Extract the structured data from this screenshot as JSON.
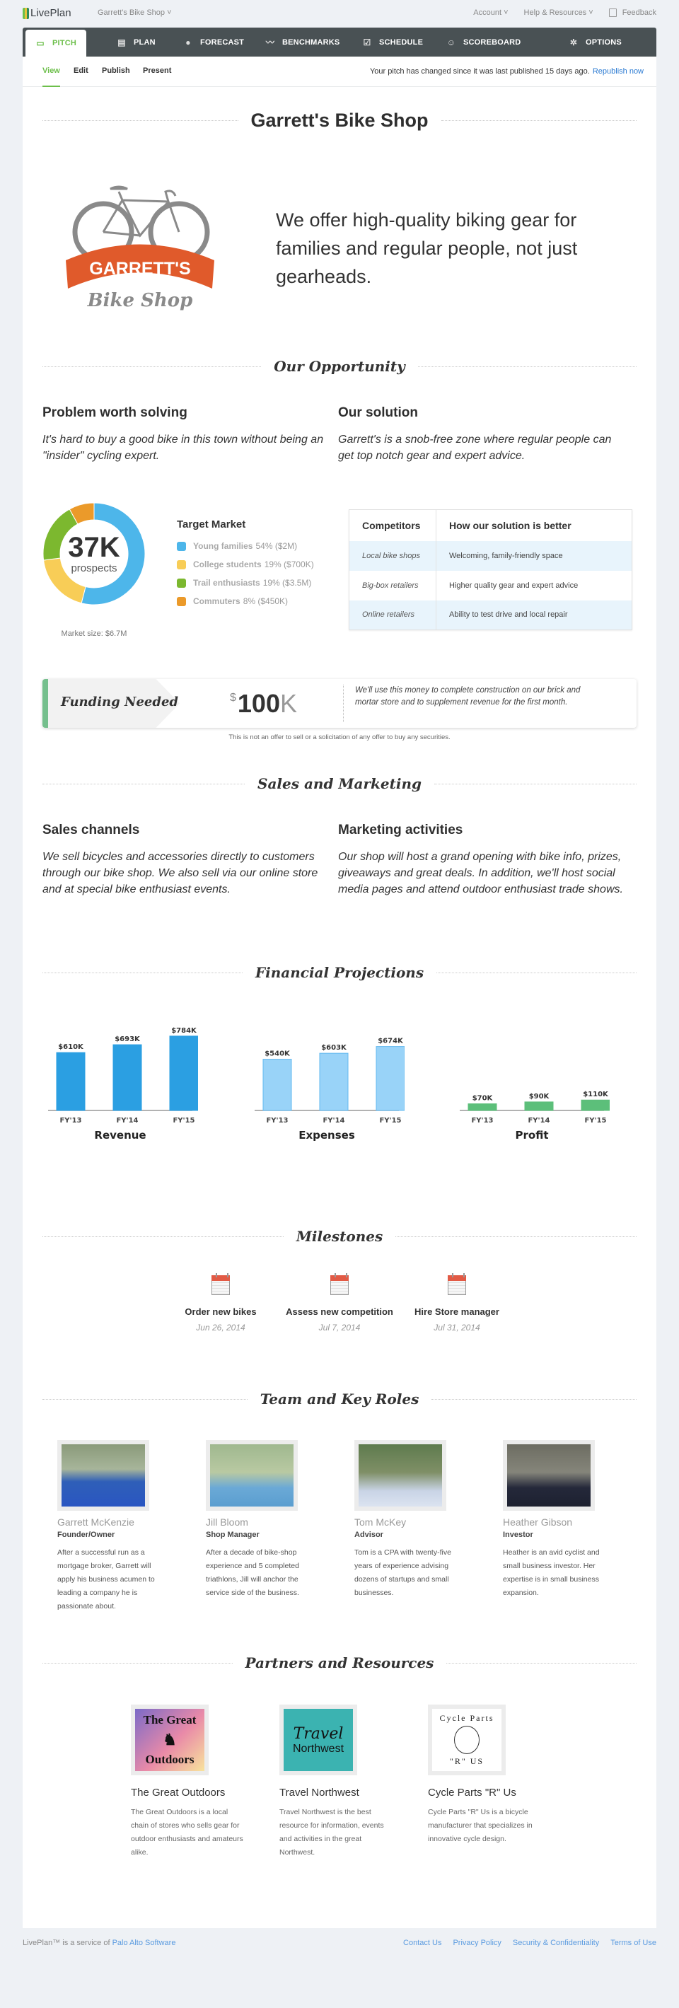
{
  "app": {
    "name": "LivePlan",
    "business": "Garrett's Bike Shop"
  },
  "topbar": {
    "account": "Account",
    "help": "Help & Resources",
    "feedback": "Feedback"
  },
  "nav": [
    {
      "label": "PITCH",
      "icon": "monitor-icon",
      "glyph": "▭"
    },
    {
      "label": "PLAN",
      "icon": "document-icon",
      "glyph": "▤"
    },
    {
      "label": "FORECAST",
      "icon": "piggy-bank-icon",
      "glyph": "●"
    },
    {
      "label": "BENCHMARKS",
      "icon": "trend-line-icon",
      "glyph": "〰"
    },
    {
      "label": "SCHEDULE",
      "icon": "checkbox-icon",
      "glyph": "☑"
    },
    {
      "label": "SCOREBOARD",
      "icon": "scoreboard-icon",
      "glyph": "☺"
    },
    {
      "label": "OPTIONS",
      "icon": "gear-icon",
      "glyph": "✲"
    }
  ],
  "subnav": {
    "tabs": [
      "View",
      "Edit",
      "Publish",
      "Present"
    ],
    "notice": "Your pitch has changed since it was last published 15 days ago.",
    "republish": "Republish now"
  },
  "pitch": {
    "title": "Garrett's Bike Shop",
    "logo": {
      "line1": "GARRETT'S",
      "line2": "Bike Shop"
    },
    "tagline": "We offer high-quality biking gear for families and regular people, not just gearheads."
  },
  "opportunity": {
    "title": "Our Opportunity",
    "problem_h": "Problem worth solving",
    "problem": "It's hard to buy a good bike in this town without being an \"insider\" cycling expert.",
    "solution_h": "Our solution",
    "solution": "Garrett's is a snob-free zone where regular people can get top notch gear and expert advice."
  },
  "target_market": {
    "prospects": "37K",
    "prospects_label": "prospects",
    "market_size": "Market size: $6.7M",
    "title": "Target Market",
    "segments": [
      {
        "name": "Young families",
        "detail": "54% ($2M)",
        "pct": 54,
        "color": "#4db6ea"
      },
      {
        "name": "College students",
        "detail": "19% ($700K)",
        "pct": 19,
        "color": "#f8cd57"
      },
      {
        "name": "Trail enthusiasts",
        "detail": "19% ($3.5M)",
        "pct": 19,
        "color": "#7cb82f"
      },
      {
        "name": "Commuters",
        "detail": "8% ($450K)",
        "pct": 8,
        "color": "#eb9a2a"
      }
    ]
  },
  "competitors": {
    "headers": [
      "Competitors",
      "How our solution is better"
    ],
    "rows": [
      [
        "Local bike shops",
        "Welcoming, family-friendly space"
      ],
      [
        "Big-box retailers",
        "Higher quality gear and expert advice"
      ],
      [
        "Online retailers",
        "Ability to test drive and local repair"
      ]
    ]
  },
  "funding": {
    "label": "Funding Needed",
    "currency": "$",
    "amount": "100",
    "unit": "K",
    "description": "We'll use this money to complete construction on our brick and mortar store and to supplement revenue for the first month.",
    "disclaimer": "This is not an offer to sell or a solicitation of any offer to buy any securities."
  },
  "sales": {
    "title": "Sales and Marketing",
    "channels_h": "Sales channels",
    "channels": "We sell bicycles and accessories directly to customers through our bike shop. We also sell via our online store and at special bike enthusiast events.",
    "marketing_h": "Marketing activities",
    "marketing": "Our shop will host a grand opening with bike info, prizes, giveaways and great deals. In addition, we'll host social media pages and attend outdoor enthusiast trade shows."
  },
  "financial_title": "Financial Projections",
  "chart_data": [
    {
      "type": "bar",
      "title": "Revenue",
      "categories": [
        "FY'13",
        "FY'14",
        "FY'15"
      ],
      "values": [
        610,
        693,
        784
      ],
      "labels": [
        "$610K",
        "$693K",
        "$784K"
      ],
      "unit": "$K",
      "color": "#2b9fe2",
      "ylim": [
        0,
        900
      ]
    },
    {
      "type": "bar",
      "title": "Expenses",
      "categories": [
        "FY'13",
        "FY'14",
        "FY'15"
      ],
      "values": [
        540,
        603,
        674
      ],
      "labels": [
        "$540K",
        "$603K",
        "$674K"
      ],
      "unit": "$K",
      "color": "#99d3f8",
      "ylim": [
        0,
        900
      ]
    },
    {
      "type": "bar",
      "title": "Profit",
      "categories": [
        "FY'13",
        "FY'14",
        "FY'15"
      ],
      "values": [
        70,
        90,
        110
      ],
      "labels": [
        "$70K",
        "$90K",
        "$110K"
      ],
      "unit": "$K",
      "color": "#5cbf7a",
      "ylim": [
        0,
        900
      ]
    }
  ],
  "milestones": {
    "title": "Milestones",
    "items": [
      {
        "title": "Order new bikes",
        "date": "Jun 26, 2014"
      },
      {
        "title": "Assess new competition",
        "date": "Jul 7, 2014"
      },
      {
        "title": "Hire Store manager",
        "date": "Jul 31, 2014"
      }
    ]
  },
  "team": {
    "title": "Team and Key Roles",
    "members": [
      {
        "name": "Garrett McKenzie",
        "role": "Founder/Owner",
        "bio": "After a successful run as a mortgage broker, Garrett will apply his business acumen to leading a company he is passionate about."
      },
      {
        "name": "Jill Bloom",
        "role": "Shop Manager",
        "bio": "After a decade of bike-shop experience and 5 completed triathlons, Jill will anchor the service side of the business."
      },
      {
        "name": "Tom McKey",
        "role": "Advisor",
        "bio": "Tom is a CPA with twenty-five years of experience advising dozens of startups and small businesses."
      },
      {
        "name": "Heather Gibson",
        "role": "Investor",
        "bio": "Heather is an avid cyclist and small business investor. Her expertise is in small business expansion."
      }
    ]
  },
  "partners": {
    "title": "Partners and Resources",
    "items": [
      {
        "name": "The Great Outdoors",
        "logo_top": "The Great",
        "logo_bottom": "Outdoors",
        "desc": "The Great Outdoors is a local chain of stores who sells gear for outdoor enthusiasts and amateurs alike."
      },
      {
        "name": "Travel Northwest",
        "logo_top": "Travel",
        "logo_bottom": "Northwest",
        "desc": "Travel Northwest is the best resource for information, events and activities in the great Northwest."
      },
      {
        "name": "Cycle Parts \"R\" Us",
        "logo_top": "Cycle Parts",
        "logo_bottom": "\"R\" US",
        "desc": "Cycle Parts \"R\" Us is a bicycle manufacturer that specializes in innovative cycle design."
      }
    ]
  },
  "footer": {
    "prefix": "LivePlan™ is a service of",
    "company": "Palo Alto Software",
    "links": [
      "Contact Us",
      "Privacy Policy",
      "Security & Confidentiality",
      "Terms of Use"
    ]
  }
}
